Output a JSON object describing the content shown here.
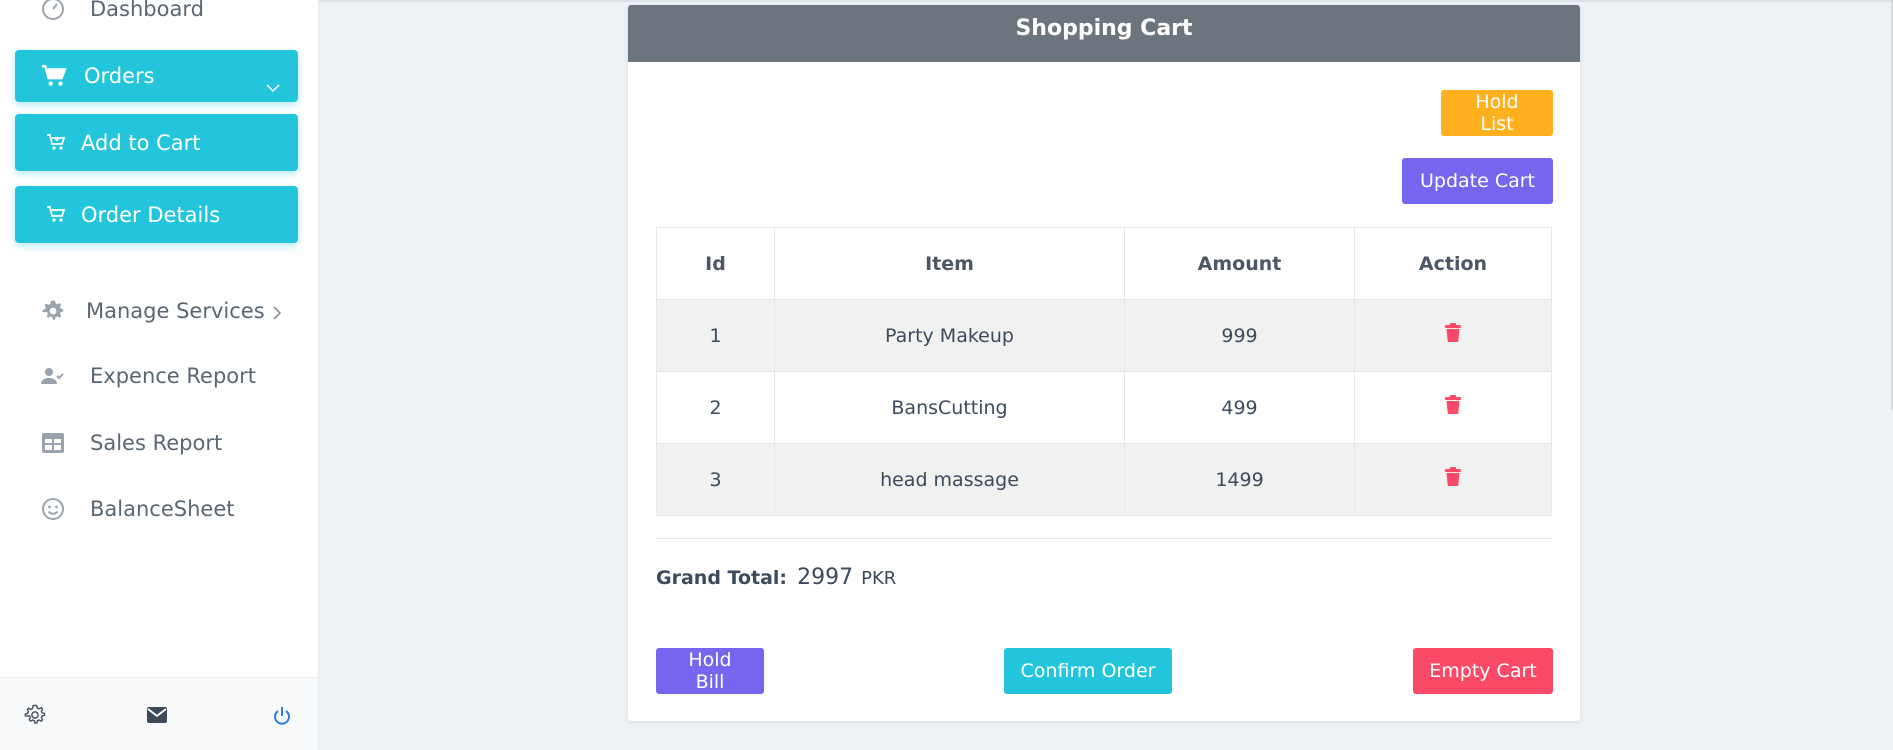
{
  "sidebar": {
    "dashboard_label": "Dashboard",
    "orders_label": "Orders",
    "add_to_cart_label": "Add to Cart",
    "order_details_label": "Order Details",
    "items": [
      {
        "label": "Manage Services",
        "icon": "gear-icon"
      },
      {
        "label": "Expence Report",
        "icon": "user-check-icon"
      },
      {
        "label": "Sales Report",
        "icon": "table-icon"
      },
      {
        "label": "BalanceSheet",
        "icon": "smiley-icon"
      }
    ],
    "footer_icons": [
      "settings-icon",
      "mail-icon",
      "power-icon"
    ]
  },
  "cart": {
    "title": "Shopping Cart",
    "hold_list_label": "Hold List",
    "update_cart_label": "Update Cart",
    "columns": [
      "Id",
      "Item",
      "Amount",
      "Action"
    ],
    "rows": [
      {
        "id": "1",
        "item": "Party Makeup",
        "amount": "999"
      },
      {
        "id": "2",
        "item": "BansCutting",
        "amount": "499"
      },
      {
        "id": "3",
        "item": "head massage",
        "amount": "1499"
      }
    ],
    "grand_total_label": "Grand Total:",
    "grand_total_value": "2997",
    "currency": "PKR",
    "hold_bill_label": "Hold Bill",
    "confirm_order_label": "Confirm Order",
    "empty_cart_label": "Empty Cart"
  },
  "colors": {
    "accent": "#22c5dc",
    "purple": "#7565ef",
    "warning": "#ffb01f",
    "danger": "#fb4a68",
    "header": "#6c757d"
  }
}
